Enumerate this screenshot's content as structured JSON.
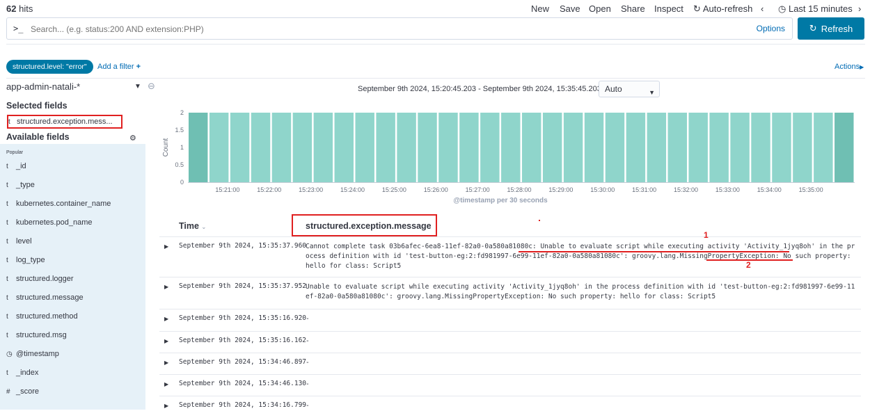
{
  "top": {
    "hits_count": "62",
    "hits_label": "hits",
    "menu": [
      "New",
      "Save",
      "Open",
      "Share",
      "Inspect"
    ],
    "auto_refresh": "Auto-refresh",
    "time_label": "Last 15 minutes"
  },
  "query": {
    "prompt": ">_",
    "placeholder": "Search... (e.g. status:200 AND extension:PHP)",
    "options": "Options",
    "refresh": "Refresh"
  },
  "filters": {
    "pill": "structured.level: \"error\"",
    "add_filter": "Add a filter",
    "actions": "Actions"
  },
  "sidebar": {
    "index_pattern": "app-admin-natali-*",
    "selected_title": "Selected fields",
    "selected_field": "structured.exception.mess...",
    "available_title": "Available fields",
    "popular_label": "Popular",
    "fields": [
      {
        "type": "t",
        "name": "_id"
      },
      {
        "type": "t",
        "name": "_type"
      },
      {
        "type": "t",
        "name": "kubernetes.container_name"
      },
      {
        "type": "t",
        "name": "kubernetes.pod_name"
      },
      {
        "type": "t",
        "name": "level"
      },
      {
        "type": "t",
        "name": "log_type"
      },
      {
        "type": "t",
        "name": "structured.logger"
      },
      {
        "type": "t",
        "name": "structured.message"
      },
      {
        "type": "t",
        "name": "structured.method"
      },
      {
        "type": "t",
        "name": "structured.msg"
      },
      {
        "type": "clock",
        "name": "@timestamp"
      },
      {
        "type": "t",
        "name": "_index"
      },
      {
        "type": "#",
        "name": "_score"
      }
    ]
  },
  "histogram": {
    "date_range": "September 9th 2024, 15:20:45.203 - September 9th 2024, 15:35:45.203 —",
    "interval": "Auto"
  },
  "chart_data": {
    "type": "bar",
    "ylabel": "Count",
    "xlabel": "@timestamp per 30 seconds",
    "ylim": [
      0,
      2
    ],
    "yticks": [
      "0",
      "0.5",
      "1",
      "1.5",
      "2"
    ],
    "xticks": [
      "15:21:00",
      "15:22:00",
      "15:23:00",
      "15:24:00",
      "15:25:00",
      "15:26:00",
      "15:27:00",
      "15:28:00",
      "15:29:00",
      "15:30:00",
      "15:31:00",
      "15:32:00",
      "15:33:00",
      "15:34:00",
      "15:35:00"
    ],
    "values": [
      2,
      2,
      2,
      2,
      2,
      2,
      2,
      2,
      2,
      2,
      2,
      2,
      2,
      2,
      2,
      2,
      2,
      2,
      2,
      2,
      2,
      2,
      2,
      2,
      2,
      2,
      2,
      2,
      2,
      2,
      2,
      2
    ],
    "bar_color": "#8fd5cb",
    "edge_bar_color": "#6fbfb3"
  },
  "table": {
    "col_time": "Time",
    "col_message": "structured.exception.message",
    "rows": [
      {
        "time": "September 9th 2024, 15:35:37.960",
        "message": "Cannot complete task 03b6afec-6ea8-11ef-82a0-0a580a81080c: Unable to evaluate script while executing activity 'Activity_1jyq8oh' in the process definition with id 'test-button-eg:2:fd981997-6e99-11ef-82a0-0a580a81080c': groovy.lang.MissingPropertyException: No such property: hello for class: Script5"
      },
      {
        "time": "September 9th 2024, 15:35:37.952",
        "message": "Unable to evaluate script while executing activity 'Activity_1jyq8oh' in the process definition with id 'test-button-eg:2:fd981997-6e99-11ef-82a0-0a580a81080c': groovy.lang.MissingPropertyException: No such property: hello for class: Script5"
      },
      {
        "time": "September 9th 2024, 15:35:16.920",
        "message": "-"
      },
      {
        "time": "September 9th 2024, 15:35:16.162",
        "message": "-"
      },
      {
        "time": "September 9th 2024, 15:34:46.897",
        "message": "-"
      },
      {
        "time": "September 9th 2024, 15:34:46.130",
        "message": "-"
      },
      {
        "time": "September 9th 2024, 15:34:16.799",
        "message": "-"
      }
    ]
  },
  "annotations": {
    "first": "1",
    "second": "2",
    "color": "#e02020"
  }
}
